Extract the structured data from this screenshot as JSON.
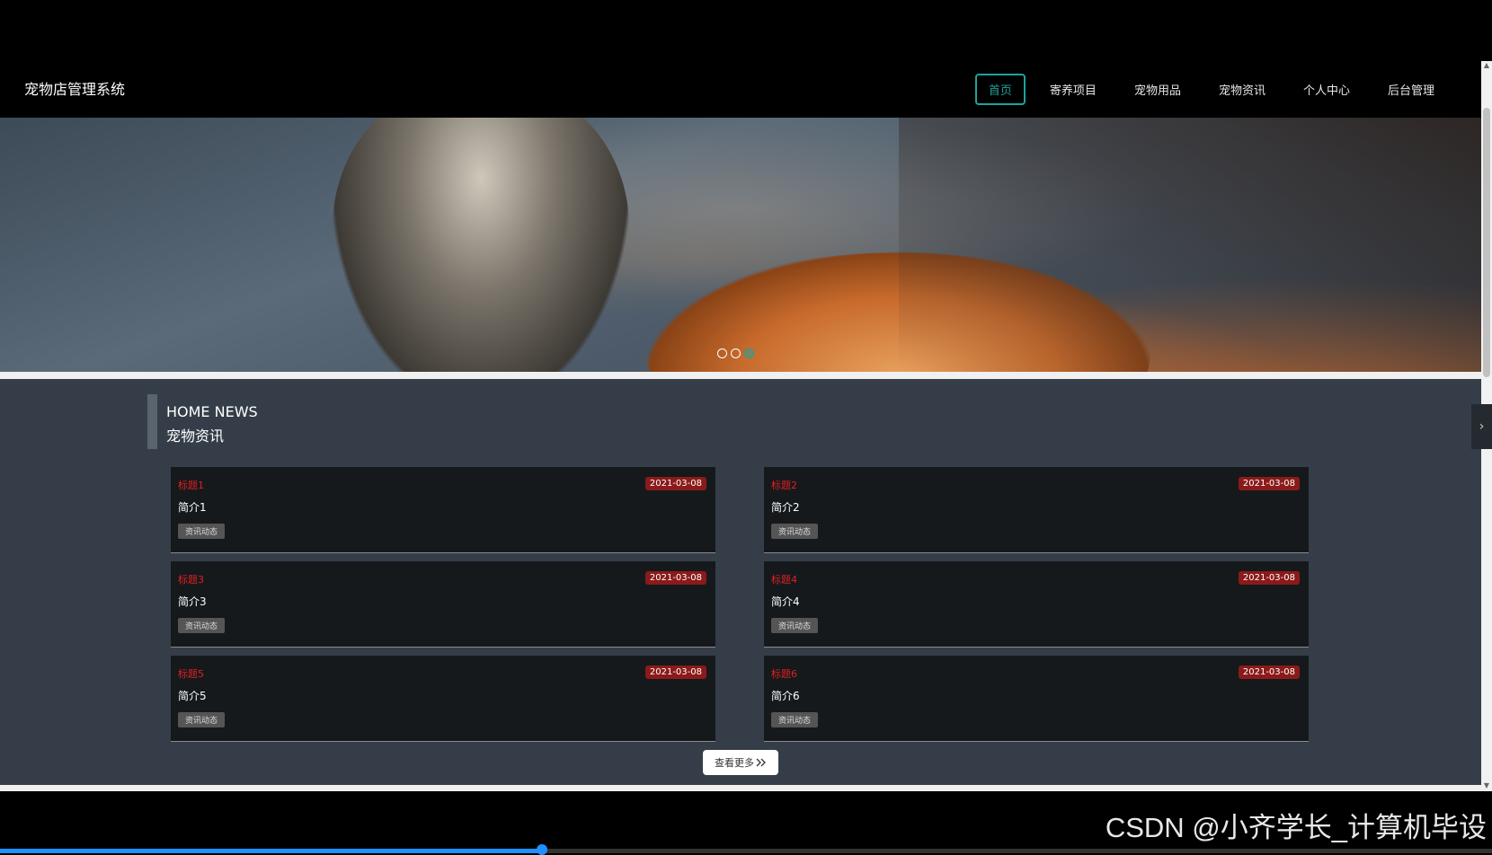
{
  "header": {
    "brand": "宠物店管理系统",
    "nav": [
      {
        "label": "首页",
        "active": true
      },
      {
        "label": "寄养项目",
        "active": false
      },
      {
        "label": "宠物用品",
        "active": false
      },
      {
        "label": "宠物资讯",
        "active": false
      },
      {
        "label": "个人中心",
        "active": false
      },
      {
        "label": "后台管理",
        "active": false
      }
    ]
  },
  "banner": {
    "slides_count": 3,
    "active_slide": 3
  },
  "news": {
    "heading_en": "HOME NEWS",
    "heading_cn": "宠物资讯",
    "items": [
      {
        "title": "标题1",
        "date": "2021-03-08",
        "summary": "简介1",
        "tag": "资讯动态"
      },
      {
        "title": "标题2",
        "date": "2021-03-08",
        "summary": "简介2",
        "tag": "资讯动态"
      },
      {
        "title": "标题3",
        "date": "2021-03-08",
        "summary": "简介3",
        "tag": "资讯动态"
      },
      {
        "title": "标题4",
        "date": "2021-03-08",
        "summary": "简介4",
        "tag": "资讯动态"
      },
      {
        "title": "标题5",
        "date": "2021-03-08",
        "summary": "简介5",
        "tag": "资讯动态"
      },
      {
        "title": "标题6",
        "date": "2021-03-08",
        "summary": "简介6",
        "tag": "资讯动态"
      }
    ],
    "more_label": "查看更多"
  },
  "watermark": "CSDN @小齐学长_计算机毕设",
  "colors": {
    "accent": "#1fa39a",
    "title_red": "#e02020",
    "date_badge": "#8b1a1a",
    "section_bg": "#353e48",
    "card_bg": "#15191c"
  }
}
